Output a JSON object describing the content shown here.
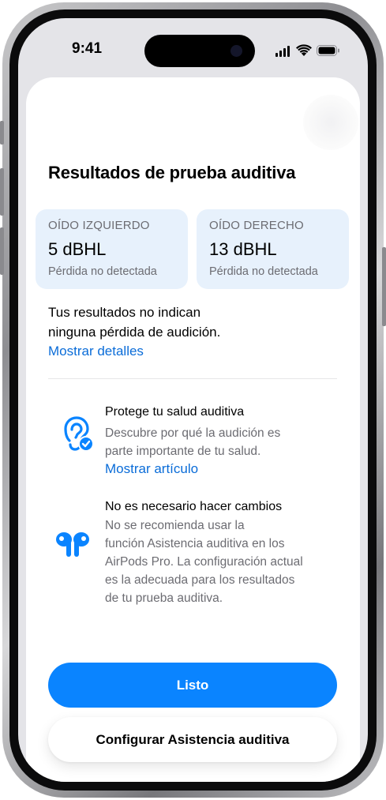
{
  "status_bar": {
    "time": "9:41"
  },
  "sheet": {
    "title": "Resultados de prueba auditiva",
    "left_ear": {
      "label": "OÍDO IZQUIERDO",
      "value": "5 dBHL",
      "status": "Pérdida no detectada"
    },
    "right_ear": {
      "label": "OÍDO DERECHO",
      "value": "13 dBHL",
      "status": "Pérdida no detectada"
    },
    "summary_lines": [
      "Tus resultados no indican",
      "ninguna pérdida de audición."
    ],
    "details_link": "Mostrar detalles",
    "info_items": [
      {
        "icon": "ear-checkmark-icon",
        "title": "Protege tu salud auditiva",
        "text_lines": [
          "Descubre por qué la audición es",
          "parte importante de tu salud."
        ],
        "link": "Mostrar artículo"
      },
      {
        "icon": "airpods-pro-icon",
        "title": "No es necesario hacer cambios",
        "text_lines": [
          "No se recomienda usar la",
          "función Asistencia auditiva en los",
          "AirPods Pro. La configuración actual",
          "es la adecuada para los resultados",
          "de tu prueba auditiva."
        ]
      }
    ],
    "primary_button": "Listo",
    "secondary_button": "Configurar Asistencia auditiva"
  },
  "colors": {
    "accent": "#0a84ff",
    "link": "#0a6cd8",
    "card_background": "#e7f1fc",
    "secondary_text": "#6c6c72"
  }
}
